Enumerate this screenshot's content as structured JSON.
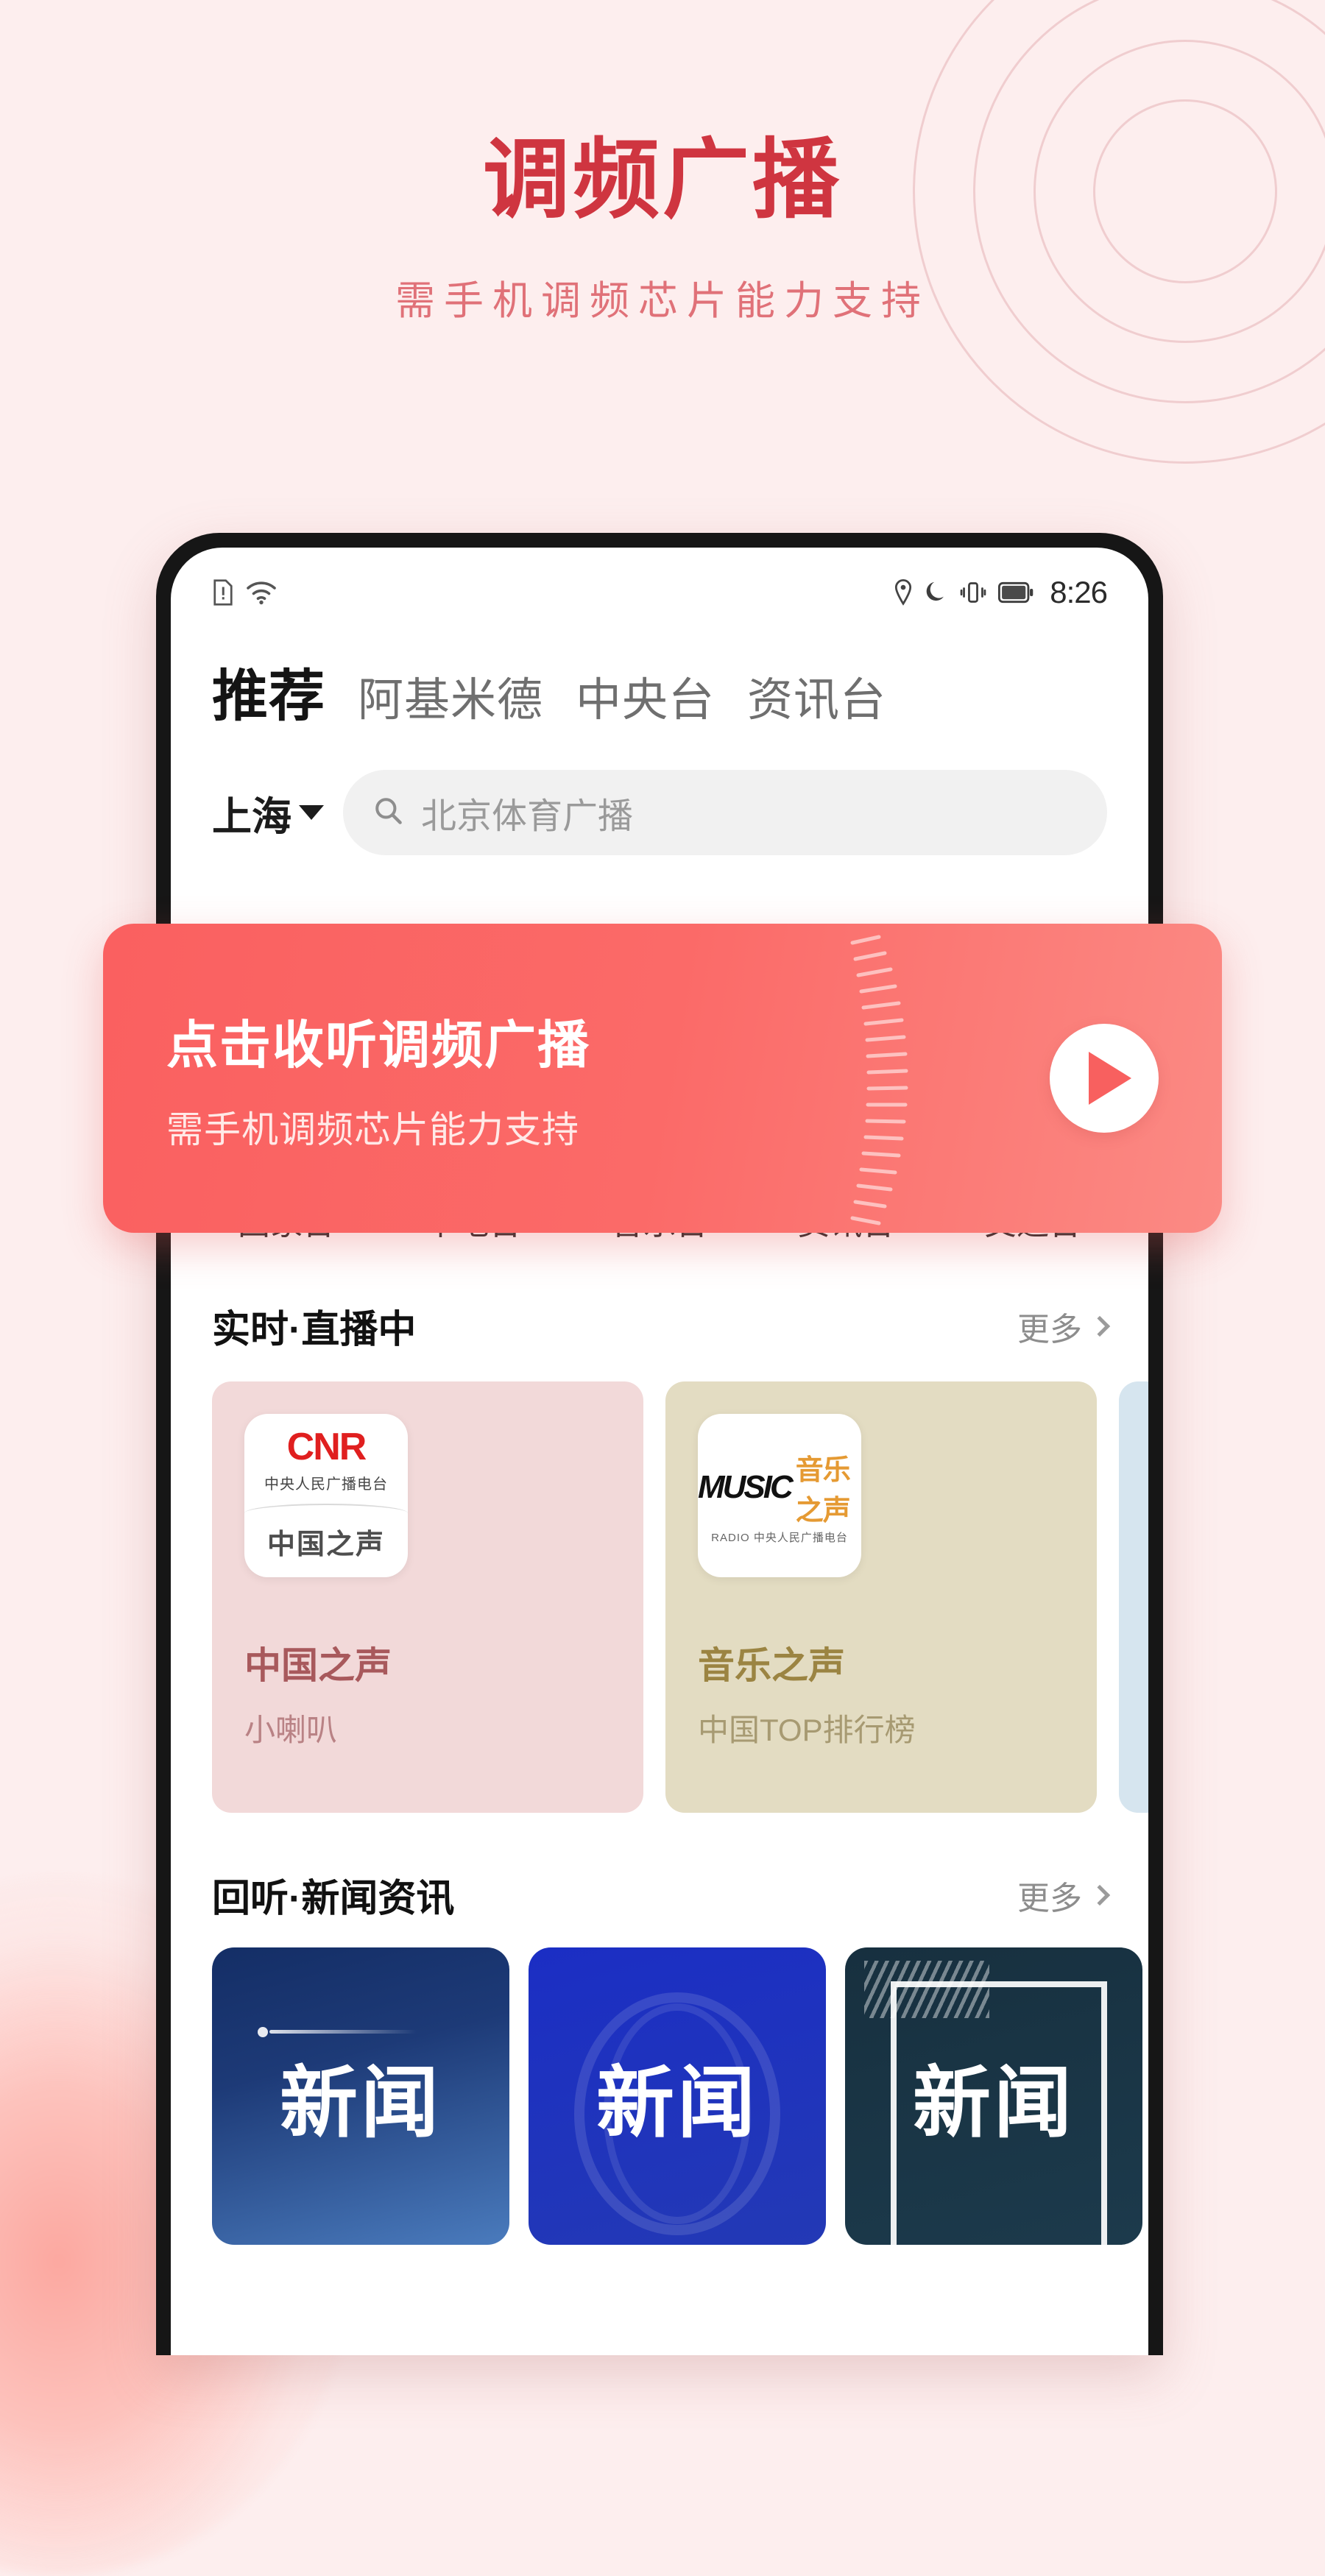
{
  "promo": {
    "title": "调频广播",
    "subtitle": "需手机调频芯片能力支持",
    "title_color": "#cf3540",
    "subtitle_color": "#e07178",
    "background_color": "#fdeeee"
  },
  "phone": {
    "status_bar": {
      "sim_icon": "sim-alert-icon",
      "wifi_icon": "wifi-icon",
      "location_icon": "location-pin-icon",
      "dnd_icon": "moon-icon",
      "vibrate_icon": "vibrate-icon",
      "battery_icon": "battery-icon",
      "time": "8:26"
    },
    "tabs": [
      {
        "label": "推荐",
        "active": true
      },
      {
        "label": "阿基米德",
        "active": false
      },
      {
        "label": "中央台",
        "active": false
      },
      {
        "label": "资讯台",
        "active": false
      }
    ],
    "search": {
      "city": "上海",
      "caret_icon": "chevron-down-icon",
      "search_icon": "search-icon",
      "placeholder": "北京体育广播",
      "value": ""
    },
    "fm_banner": {
      "title": "点击收听调频广播",
      "subtitle": "需手机调频芯片能力支持",
      "play_icon": "play-icon",
      "accent_color": "#fa6060"
    },
    "categories": [
      {
        "label": "国家台",
        "icon": "crown-icon",
        "color_from": "#f2857f",
        "color_to": "#ee5f62"
      },
      {
        "label": "本地台",
        "icon": "map-pin-icon",
        "color_from": "#fb7a74",
        "color_to": "#f4524f"
      },
      {
        "label": "音乐台",
        "icon": "radio-music-icon",
        "color_from": "#b79cea",
        "color_to": "#9c7ee0"
      },
      {
        "label": "资讯台",
        "icon": "chat-bubble-icon",
        "color_from": "#f7c458",
        "color_to": "#edab3a"
      },
      {
        "label": "交通台",
        "icon": "car-icon",
        "color_from": "#6ec99e",
        "color_to": "#4cb584"
      }
    ],
    "live_section": {
      "title": "实时·直播中",
      "more_label": "更多",
      "more_icon": "chevron-right-icon",
      "cards": [
        {
          "title": "中国之声",
          "subtitle": "小喇叭",
          "bg": "#f2d9d9",
          "title_color": "#a8595c",
          "subtitle_color": "#b98285",
          "logo_type": "cnr",
          "logo_word": "CNR",
          "logo_cn": "中央人民广播电台",
          "logo_bottom": "中国之声"
        },
        {
          "title": "音乐之声",
          "subtitle": "中国TOP排行榜",
          "bg": "#e3dcc2",
          "title_color": "#9b8442",
          "subtitle_color": "#a79a72",
          "logo_type": "music",
          "logo_word": "MUSIC",
          "logo_cn": "音乐之声",
          "logo_bottom": "RADIO 中央人民广播电台"
        },
        {
          "title": "",
          "subtitle": "",
          "bg": "#d6e5ef",
          "title_color": "#6f90a5",
          "subtitle_color": "#8aa7ba",
          "logo_type": "none",
          "logo_word": "",
          "logo_cn": "",
          "logo_bottom": ""
        }
      ]
    },
    "news_section": {
      "title": "回听·新闻资讯",
      "more_label": "更多",
      "more_icon": "chevron-right-icon",
      "cards": [
        {
          "label": "新闻",
          "bg_from": "#1d3a77",
          "bg_to": "#4a7bbd"
        },
        {
          "label": "新闻",
          "bg_from": "#1b2ec4",
          "bg_to": "#2339b5"
        },
        {
          "label": "新闻",
          "bg_from": "#17303f",
          "bg_to": "#1c3a4c"
        }
      ]
    }
  }
}
